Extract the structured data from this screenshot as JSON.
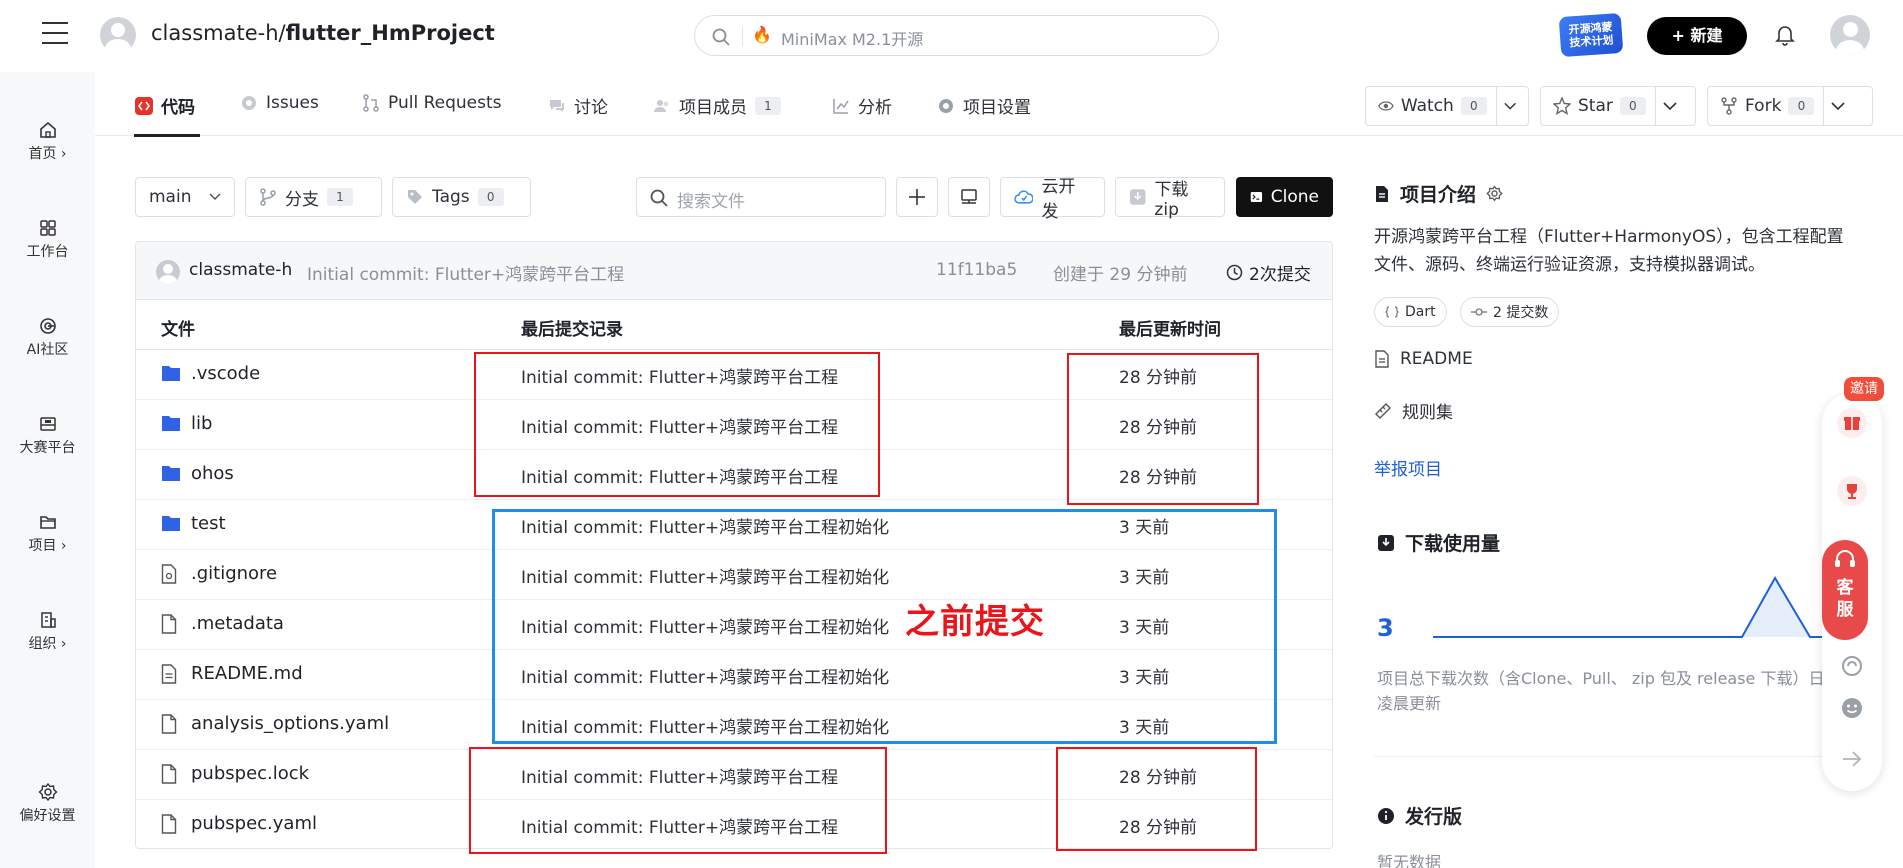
{
  "header": {
    "repo_owner": "classmate-h/",
    "repo_name": "flutter_HmProject",
    "search_placeholder": "MiniMax M2.1开源",
    "promo_line1": "开源鸿蒙",
    "promo_line2": "技术计划",
    "new_label": "+ 新建"
  },
  "rail": {
    "items": [
      {
        "label": "首页 ›",
        "icon": "home-icon"
      },
      {
        "label": "工作台",
        "icon": "workspace-icon"
      },
      {
        "label": "AI社区",
        "icon": "ai-icon"
      },
      {
        "label": "大赛平台",
        "icon": "contest-icon"
      },
      {
        "label": "项目 ›",
        "icon": "folder-icon"
      },
      {
        "label": "组织 ›",
        "icon": "org-icon"
      }
    ],
    "settings_label": "偏好设置"
  },
  "tabs": {
    "code": "代码",
    "issues": "Issues",
    "pulls": "Pull Requests",
    "discuss": "讨论",
    "members": "项目成员",
    "members_count": "1",
    "analysis": "分析",
    "settings": "项目设置"
  },
  "repo_actions": {
    "watch": "Watch",
    "watch_count": "0",
    "star": "Star",
    "star_count": "0",
    "fork": "Fork",
    "fork_count": "0"
  },
  "toolbar": {
    "branch": "main",
    "branches_label": "分支",
    "branches_count": "1",
    "tags_label": "Tags",
    "tags_count": "0",
    "search_placeholder": "搜索文件",
    "cloud_dev": "云开发",
    "download_zip": "下载zip",
    "clone": "Clone"
  },
  "latest_commit": {
    "author": "classmate-h",
    "message": "Initial commit: Flutter+鸿蒙跨平台工程",
    "hash": "11f11ba5",
    "created": "创建于 29 分钟前",
    "commits": "2次提交"
  },
  "table": {
    "col_file": "文件",
    "col_commit": "最后提交记录",
    "col_time": "最后更新时间",
    "rows": [
      {
        "name": ".vscode",
        "type": "folder",
        "commit": "Initial commit: Flutter+鸿蒙跨平台工程",
        "time": "28 分钟前"
      },
      {
        "name": "lib",
        "type": "folder",
        "commit": "Initial commit: Flutter+鸿蒙跨平台工程",
        "time": "28 分钟前"
      },
      {
        "name": "ohos",
        "type": "folder",
        "commit": "Initial commit: Flutter+鸿蒙跨平台工程",
        "time": "28 分钟前"
      },
      {
        "name": "test",
        "type": "folder",
        "commit": "Initial commit: Flutter+鸿蒙跨平台工程初始化",
        "time": "3 天前"
      },
      {
        "name": ".gitignore",
        "type": "gitignore",
        "commit": "Initial commit: Flutter+鸿蒙跨平台工程初始化",
        "time": "3 天前"
      },
      {
        "name": ".metadata",
        "type": "file",
        "commit": "Initial commit: Flutter+鸿蒙跨平台工程初始化",
        "time": "3 天前"
      },
      {
        "name": "README.md",
        "type": "doc",
        "commit": "Initial commit: Flutter+鸿蒙跨平台工程初始化",
        "time": "3 天前"
      },
      {
        "name": "analysis_options.yaml",
        "type": "file",
        "commit": "Initial commit: Flutter+鸿蒙跨平台工程初始化",
        "time": "3 天前"
      },
      {
        "name": "pubspec.lock",
        "type": "file",
        "commit": "Initial commit: Flutter+鸿蒙跨平台工程",
        "time": "28 分钟前"
      },
      {
        "name": "pubspec.yaml",
        "type": "file",
        "commit": "Initial commit: Flutter+鸿蒙跨平台工程",
        "time": "28 分钟前"
      }
    ]
  },
  "annotation": {
    "label": "之前提交",
    "red_color": "#e8161b",
    "blue_color": "#1e8fe3"
  },
  "sidebar": {
    "intro_title": "项目介绍",
    "intro_desc": "开源鸿蒙跨平台工程（Flutter+HarmonyOS），包含工程配置文件、源码、终端运行验证资源，支持模拟器调试。",
    "lang_chip": "Dart",
    "commits_chip": "2 提交数",
    "readme": "README",
    "rules": "规则集",
    "report": "举报项目",
    "downloads_title": "下载使用量",
    "downloads_value": "3",
    "downloads_note": "项目总下载次数（含Clone、Pull、 zip 包及 release 下载）日凌晨更新",
    "release_title": "发行版",
    "release_empty": "暂无数据"
  },
  "floating": {
    "invite": "邀请",
    "service": "客服"
  }
}
